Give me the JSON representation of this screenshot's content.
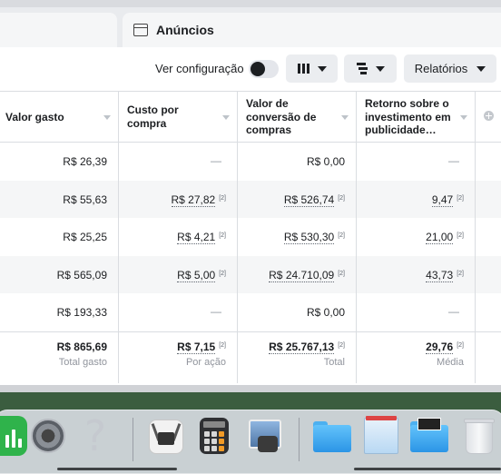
{
  "tabs": {
    "ads_label": "Anúncios"
  },
  "toolbar": {
    "config_label": "Ver configuração",
    "config_toggle_on": false,
    "reports_label": "Relatórios"
  },
  "table": {
    "headers": [
      [
        "Valor gasto"
      ],
      [
        "Custo por",
        "compra"
      ],
      [
        "Valor de",
        "conversão de",
        "compras"
      ],
      [
        "Retorno sobre o",
        "investimento em",
        "publicidade…"
      ]
    ],
    "rows": [
      {
        "spent": "R$ 26,39",
        "cpa": "—",
        "cpa_note": "",
        "conv": "R$ 0,00",
        "conv_note": "",
        "roas": "—",
        "roas_note": ""
      },
      {
        "spent": "R$ 55,63",
        "cpa": "R$ 27,82",
        "cpa_note": "[2]",
        "conv": "R$ 526,74",
        "conv_note": "[2]",
        "roas": "9,47",
        "roas_note": "[2]"
      },
      {
        "spent": "R$ 25,25",
        "cpa": "R$ 4,21",
        "cpa_note": "[2]",
        "conv": "R$ 530,30",
        "conv_note": "[2]",
        "roas": "21,00",
        "roas_note": "[2]"
      },
      {
        "spent": "R$ 565,09",
        "cpa": "R$ 5,00",
        "cpa_note": "[2]",
        "conv": "R$ 24.710,09",
        "conv_note": "[2]",
        "roas": "43,73",
        "roas_note": "[2]"
      },
      {
        "spent": "R$ 193,33",
        "cpa": "—",
        "cpa_note": "",
        "conv": "R$ 0,00",
        "conv_note": "",
        "roas": "—",
        "roas_note": ""
      }
    ],
    "totals": {
      "spent": "R$ 865,69",
      "spent_sub": "Total gasto",
      "cpa": "R$ 7,15",
      "cpa_note": "[2]",
      "cpa_sub": "Por ação",
      "conv": "R$ 25.767,13",
      "conv_note": "[2]",
      "conv_sub": "Total",
      "roas": "29,76",
      "roas_note": "[2]",
      "roas_sub": "Média"
    }
  },
  "dock": {
    "icons": [
      "numbers-icon",
      "system-preferences-icon",
      "unknown-app-icon",
      "accessibility-inspector-icon",
      "calculator-icon",
      "preview-icon",
      "folder-icon",
      "documents-stack-icon",
      "downloads-folder-icon",
      "trash-icon"
    ]
  },
  "colors": {
    "panel_bg": "#ffffff",
    "alt_row_bg": "#f5f6f7",
    "button_bg": "#ebedf0",
    "muted_text": "#90949c"
  }
}
